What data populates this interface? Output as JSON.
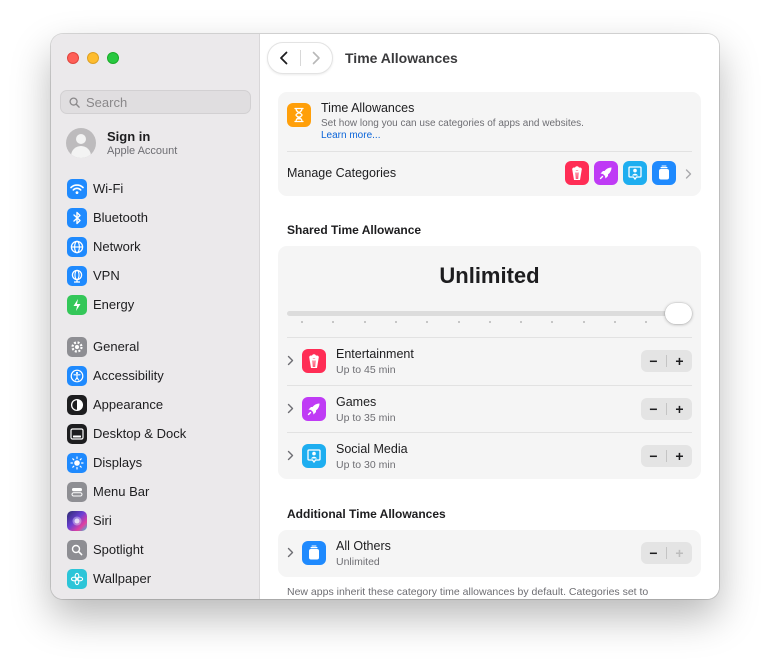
{
  "sidebar": {
    "search_placeholder": "Search",
    "account": {
      "title": "Sign in",
      "subtitle": "Apple Account"
    },
    "group1": [
      {
        "label": "Wi-Fi",
        "icon": "wifi-icon",
        "color": "#1f8afe"
      },
      {
        "label": "Bluetooth",
        "icon": "bluetooth-icon",
        "color": "#1f8afe"
      },
      {
        "label": "Network",
        "icon": "globe-icon",
        "color": "#1f8afe"
      },
      {
        "label": "VPN",
        "icon": "vpn-globe-icon",
        "color": "#1f8afe"
      },
      {
        "label": "Energy",
        "icon": "bolt-icon",
        "color": "#34c759"
      }
    ],
    "group2": [
      {
        "label": "General",
        "icon": "gear-icon",
        "color": "#8e8e93"
      },
      {
        "label": "Accessibility",
        "icon": "accessibility-icon",
        "color": "#1f8afe"
      },
      {
        "label": "Appearance",
        "icon": "appearance-icon",
        "color": "#1d1d1f"
      },
      {
        "label": "Desktop & Dock",
        "icon": "dock-icon",
        "color": "#1d1d1f"
      },
      {
        "label": "Displays",
        "icon": "sun-icon",
        "color": "#1f8afe"
      },
      {
        "label": "Menu Bar",
        "icon": "menubar-icon",
        "color": "#8e8e93"
      },
      {
        "label": "Siri",
        "icon": "siri-icon",
        "color": "#6b3fd4"
      },
      {
        "label": "Spotlight",
        "icon": "spotlight-icon",
        "color": "#8e8e93"
      },
      {
        "label": "Wallpaper",
        "icon": "wallpaper-icon",
        "color": "#2cc5d8"
      }
    ]
  },
  "main": {
    "title": "Time Allowances",
    "intro": {
      "title": "Time Allowances",
      "description": "Set how long you can use categories of apps and websites.",
      "link": "Learn more..."
    },
    "manage_categories": "Manage Categories",
    "shared": {
      "section_title": "Shared Time Allowance",
      "value": "Unlimited",
      "slider_level": 1.0,
      "categories": [
        {
          "name": "Entertainment",
          "limit": "Up to 45 min",
          "icon": "popcorn-icon",
          "color": "#ff2d55"
        },
        {
          "name": "Games",
          "limit": "Up to 35 min",
          "icon": "rocket-icon",
          "color": "#bf3bf5"
        },
        {
          "name": "Social Media",
          "limit": "Up to 30 min",
          "icon": "person-bubble-icon",
          "color": "#1eaef0"
        }
      ]
    },
    "additional": {
      "section_title": "Additional Time Allowances",
      "categories": [
        {
          "name": "All Others",
          "limit": "Unlimited",
          "icon": "stack-icon",
          "color": "#1f8afe"
        }
      ],
      "footer": "New apps inherit these category time allowances by default. Categories set to"
    },
    "stepper": {
      "minus": "−",
      "plus": "+"
    }
  }
}
